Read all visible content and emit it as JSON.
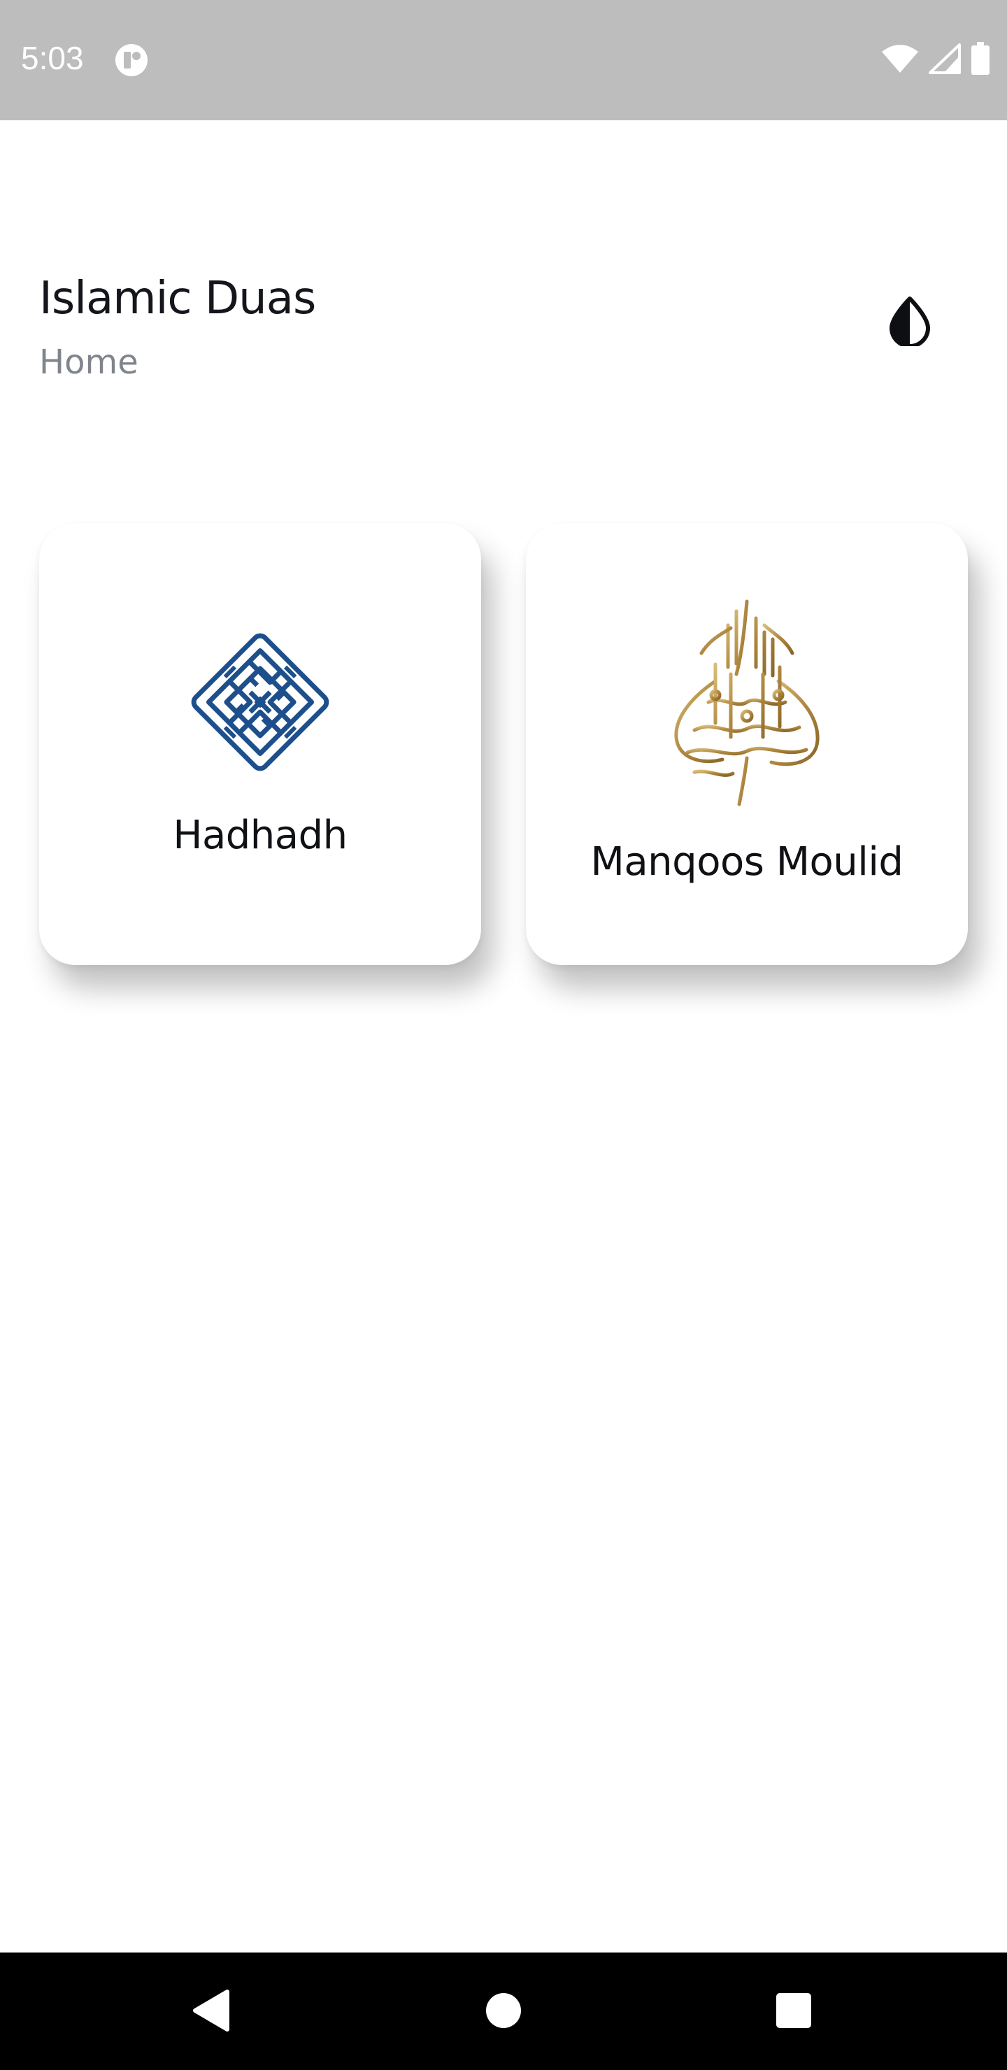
{
  "status_bar": {
    "time": "5:03",
    "app_icon": "app-notification-icon",
    "icons": [
      "wifi-icon",
      "cellular-signal-icon",
      "battery-icon"
    ],
    "background": "#bdbdbd"
  },
  "header": {
    "title": "Islamic Duas",
    "subtitle": "Home",
    "theme_toggle_icon": "contrast-icon"
  },
  "cards": [
    {
      "label": "Hadhadh",
      "icon": "kufic-calligraphy-logo",
      "accent": "#1d4f8c"
    },
    {
      "label": "Manqoos Moulid",
      "icon": "bismillah-calligraphy-logo",
      "accent": "#b8924a"
    }
  ],
  "nav_bar": {
    "buttons": [
      "back-icon",
      "home-icon",
      "recents-icon"
    ],
    "background": "#000000"
  }
}
